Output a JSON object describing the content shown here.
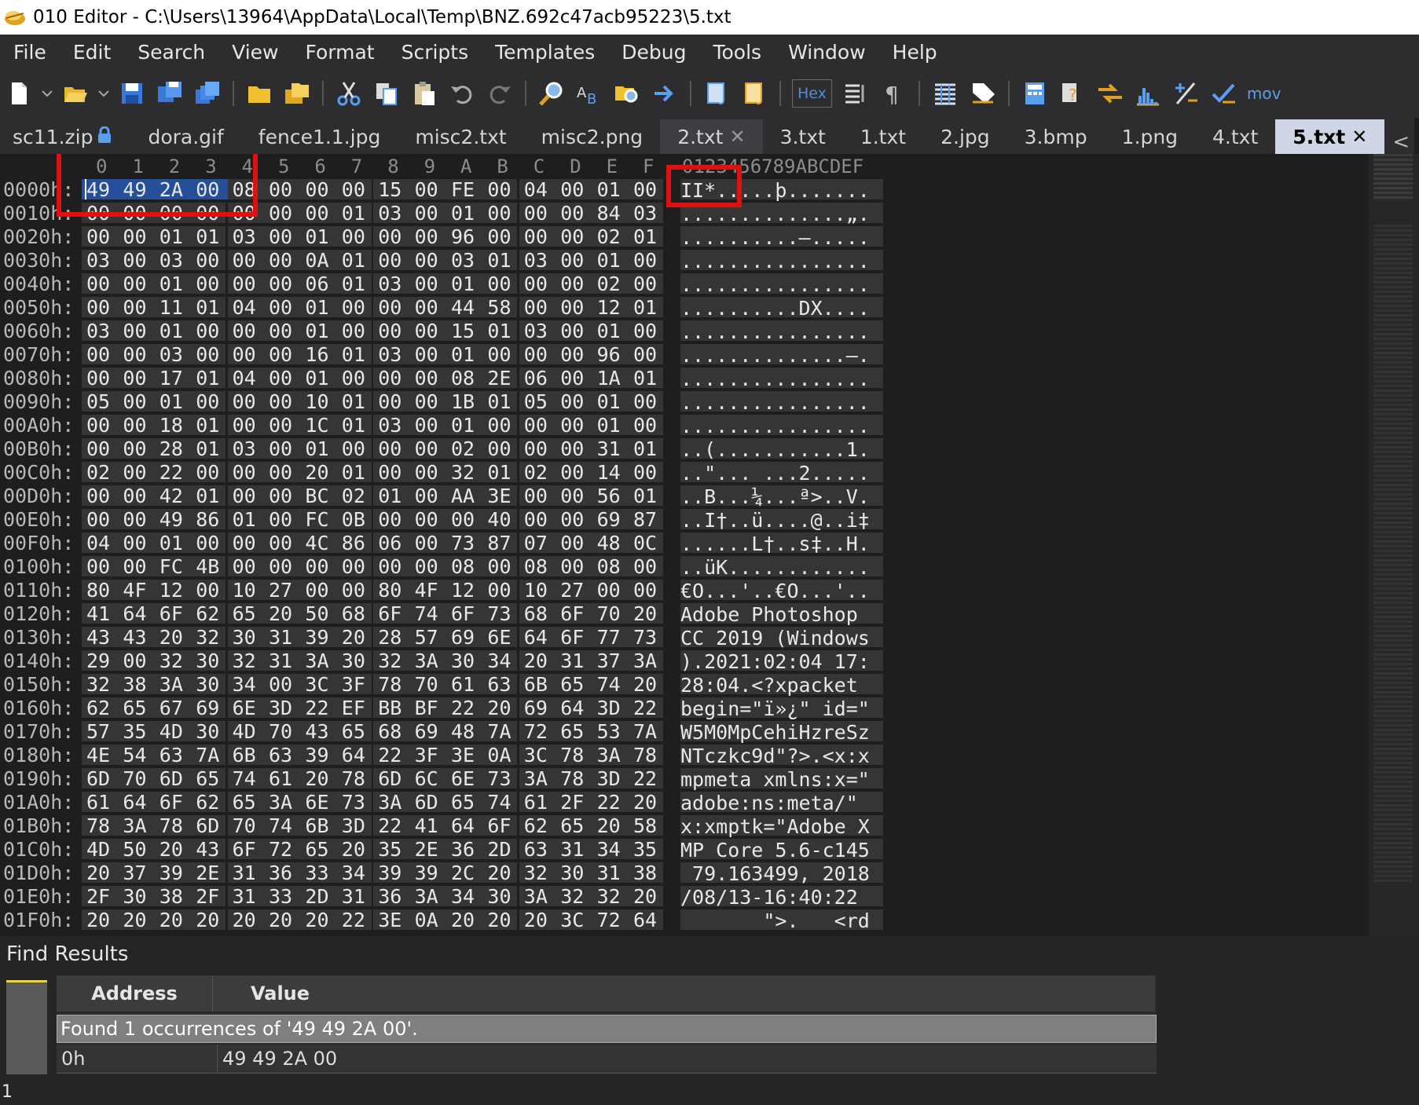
{
  "window": {
    "title": "010 Editor - C:\\Users\\13964\\AppData\\Local\\Temp\\BNZ.692c47acb95223\\5.txt"
  },
  "menu": [
    "File",
    "Edit",
    "Search",
    "View",
    "Format",
    "Scripts",
    "Templates",
    "Debug",
    "Tools",
    "Window",
    "Help"
  ],
  "toolbar": {
    "hex_label": "Hex",
    "more_label": "mov"
  },
  "tabs": [
    {
      "label": "sc11.zip",
      "locked": true
    },
    {
      "label": "dora.gif"
    },
    {
      "label": "fence1.1.jpg"
    },
    {
      "label": "misc2.txt"
    },
    {
      "label": "misc2.png"
    },
    {
      "label": "2.txt",
      "closable": true,
      "semi": true
    },
    {
      "label": "3.txt"
    },
    {
      "label": "1.txt"
    },
    {
      "label": "2.jpg"
    },
    {
      "label": "3.bmp"
    },
    {
      "label": "1.png"
    },
    {
      "label": "4.txt"
    },
    {
      "label": "5.txt",
      "closable": true,
      "active": true
    }
  ],
  "tab_nav": {
    "prev": "<",
    "next": ">"
  },
  "hex": {
    "col_headers": [
      "0",
      "1",
      "2",
      "3",
      "4",
      "5",
      "6",
      "7",
      "8",
      "9",
      "A",
      "B",
      "C",
      "D",
      "E",
      "F"
    ],
    "ascii_header": "0123456789ABCDEF",
    "rows": [
      {
        "addr": "0000h:",
        "bytes": "49 49 2A 00 08 00 00 00 15 00 FE 00 04 00 01 00",
        "ascii": "II*.....þ......."
      },
      {
        "addr": "0010h:",
        "bytes": "00 00 00 00 00 00 00 01 03 00 01 00 00 00 84 03",
        "ascii": "..............„."
      },
      {
        "addr": "0020h:",
        "bytes": "00 00 01 01 03 00 01 00 00 00 96 00 00 00 02 01",
        "ascii": "..........–....."
      },
      {
        "addr": "0030h:",
        "bytes": "03 00 03 00 00 00 0A 01 00 00 03 01 03 00 01 00",
        "ascii": "................"
      },
      {
        "addr": "0040h:",
        "bytes": "00 00 01 00 00 00 06 01 03 00 01 00 00 00 02 00",
        "ascii": "................"
      },
      {
        "addr": "0050h:",
        "bytes": "00 00 11 01 04 00 01 00 00 00 44 58 00 00 12 01",
        "ascii": "..........DX...."
      },
      {
        "addr": "0060h:",
        "bytes": "03 00 01 00 00 00 01 00 00 00 15 01 03 00 01 00",
        "ascii": "................"
      },
      {
        "addr": "0070h:",
        "bytes": "00 00 03 00 00 00 16 01 03 00 01 00 00 00 96 00",
        "ascii": "..............–."
      },
      {
        "addr": "0080h:",
        "bytes": "00 00 17 01 04 00 01 00 00 00 08 2E 06 00 1A 01",
        "ascii": "................"
      },
      {
        "addr": "0090h:",
        "bytes": "05 00 01 00 00 00 10 01 00 00 1B 01 05 00 01 00",
        "ascii": "................"
      },
      {
        "addr": "00A0h:",
        "bytes": "00 00 18 01 00 00 1C 01 03 00 01 00 00 00 01 00",
        "ascii": "................"
      },
      {
        "addr": "00B0h:",
        "bytes": "00 00 28 01 03 00 01 00 00 00 02 00 00 00 31 01",
        "ascii": "..(...........1."
      },
      {
        "addr": "00C0h:",
        "bytes": "02 00 22 00 00 00 20 01 00 00 32 01 02 00 14 00",
        "ascii": "..\"... ...2....."
      },
      {
        "addr": "00D0h:",
        "bytes": "00 00 42 01 00 00 BC 02 01 00 AA 3E 00 00 56 01",
        "ascii": "..B...¼...ª>..V."
      },
      {
        "addr": "00E0h:",
        "bytes": "00 00 49 86 01 00 FC 0B 00 00 00 40 00 00 69 87",
        "ascii": "..I†..ü....@..i‡"
      },
      {
        "addr": "00F0h:",
        "bytes": "04 00 01 00 00 00 4C 86 06 00 73 87 07 00 48 0C",
        "ascii": "......L†..s‡..H."
      },
      {
        "addr": "0100h:",
        "bytes": "00 00 FC 4B 00 00 00 00 00 00 08 00 08 00 08 00",
        "ascii": "..üK............"
      },
      {
        "addr": "0110h:",
        "bytes": "80 4F 12 00 10 27 00 00 80 4F 12 00 10 27 00 00",
        "ascii": "€O...'..€O...'.."
      },
      {
        "addr": "0120h:",
        "bytes": "41 64 6F 62 65 20 50 68 6F 74 6F 73 68 6F 70 20",
        "ascii": "Adobe Photoshop "
      },
      {
        "addr": "0130h:",
        "bytes": "43 43 20 32 30 31 39 20 28 57 69 6E 64 6F 77 73",
        "ascii": "CC 2019 (Windows"
      },
      {
        "addr": "0140h:",
        "bytes": "29 00 32 30 32 31 3A 30 32 3A 30 34 20 31 37 3A",
        "ascii": ").2021:02:04 17:"
      },
      {
        "addr": "0150h:",
        "bytes": "32 38 3A 30 34 00 3C 3F 78 70 61 63 6B 65 74 20",
        "ascii": "28:04.<?xpacket "
      },
      {
        "addr": "0160h:",
        "bytes": "62 65 67 69 6E 3D 22 EF BB BF 22 20 69 64 3D 22",
        "ascii": "begin=\"ï»¿\" id=\""
      },
      {
        "addr": "0170h:",
        "bytes": "57 35 4D 30 4D 70 43 65 68 69 48 7A 72 65 53 7A",
        "ascii": "W5M0MpCehiHzreSz"
      },
      {
        "addr": "0180h:",
        "bytes": "4E 54 63 7A 6B 63 39 64 22 3F 3E 0A 3C 78 3A 78",
        "ascii": "NTczkc9d\"?>.<x:x"
      },
      {
        "addr": "0190h:",
        "bytes": "6D 70 6D 65 74 61 20 78 6D 6C 6E 73 3A 78 3D 22",
        "ascii": "mpmeta xmlns:x=\""
      },
      {
        "addr": "01A0h:",
        "bytes": "61 64 6F 62 65 3A 6E 73 3A 6D 65 74 61 2F 22 20",
        "ascii": "adobe:ns:meta/\" "
      },
      {
        "addr": "01B0h:",
        "bytes": "78 3A 78 6D 70 74 6B 3D 22 41 64 6F 62 65 20 58",
        "ascii": "x:xmptk=\"Adobe X"
      },
      {
        "addr": "01C0h:",
        "bytes": "4D 50 20 43 6F 72 65 20 35 2E 36 2D 63 31 34 35",
        "ascii": "MP Core 5.6-c145"
      },
      {
        "addr": "01D0h:",
        "bytes": "20 37 39 2E 31 36 33 34 39 39 2C 20 32 30 31 38",
        "ascii": " 79.163499, 2018"
      },
      {
        "addr": "01E0h:",
        "bytes": "2F 30 38 2F 31 33 2D 31 36 3A 34 30 3A 32 32 20",
        "ascii": "/08/13-16:40:22 "
      },
      {
        "addr": "01F0h:",
        "bytes": "20 20 20 20 20 20 20 22 3E 0A 20 20 20 3C 72 64",
        "ascii": "       \">.   <rd"
      }
    ]
  },
  "find": {
    "title": "Find Results",
    "col_address": "Address",
    "col_value": "Value",
    "message": "Found 1 occurrences of '49 49 2A 00'.",
    "results": [
      {
        "address": "0h",
        "value": "49 49 2A 00"
      }
    ],
    "side_number": "1"
  },
  "colors": {
    "accent": "#264f9a",
    "highlight_box": "#e01010",
    "active_tab": "#cfd6e6"
  }
}
